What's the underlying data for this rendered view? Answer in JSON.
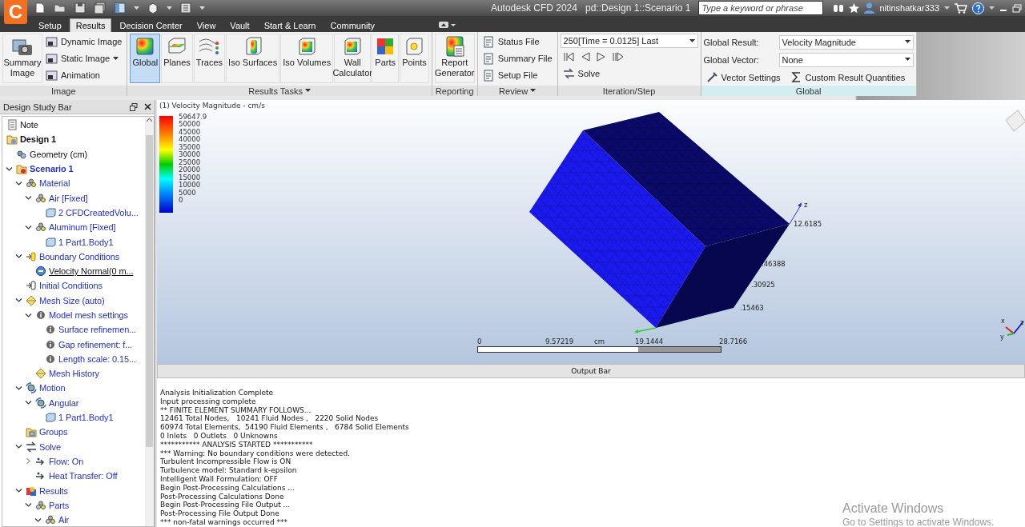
{
  "app": {
    "logo": "C",
    "title": "Autodesk CFD 2024",
    "document": "pd::Design 1::Scenario 1",
    "search": {
      "placeholder": "Type a keyword or phrase"
    },
    "user": "nitinshatkar333"
  },
  "tabs": [
    {
      "label": "Setup",
      "selected": false
    },
    {
      "label": "Results",
      "selected": true
    },
    {
      "label": "Decision Center",
      "selected": false
    },
    {
      "label": "View",
      "selected": false
    },
    {
      "label": "Vault",
      "selected": false
    },
    {
      "label": "Start & Learn",
      "selected": false
    },
    {
      "label": "Community",
      "selected": false
    }
  ],
  "ribbon": [
    {
      "kind": "image",
      "footer": "Image",
      "large": "Summary Image",
      "items": [
        {
          "label": "Dynamic Image",
          "menu": false
        },
        {
          "label": "Static Image",
          "menu": true
        },
        {
          "label": "Animation",
          "menu": false
        }
      ]
    },
    {
      "kind": "tasks",
      "footer": "Results Tasks",
      "menu": true,
      "tools": [
        {
          "label": "Global",
          "selected": true
        },
        {
          "label": "Planes",
          "selected": false
        },
        {
          "label": "Traces",
          "selected": false
        },
        {
          "label": "Iso Surfaces",
          "selected": false
        },
        {
          "label": "Iso Volumes",
          "selected": false
        },
        {
          "label": "Wall Calculator",
          "selected": false
        },
        {
          "label": "Parts",
          "selected": false
        },
        {
          "label": "Points",
          "selected": false
        }
      ]
    },
    {
      "kind": "reporting",
      "footer": "Reporting",
      "tool": "Report Generator"
    },
    {
      "kind": "review",
      "footer": "Review",
      "menu": true,
      "items": [
        {
          "label": "Status File",
          "menu": false
        },
        {
          "label": "Summary File",
          "menu": false
        },
        {
          "label": "Setup File",
          "menu": false
        }
      ]
    },
    {
      "kind": "iteration",
      "footer": "Iteration/Step",
      "step": "250[Time = 0.0125] Last",
      "action": "Solve"
    },
    {
      "kind": "global",
      "footer": "Global",
      "active": true,
      "fields": [
        {
          "label": "Global Result:",
          "value": "Velocity Magnitude"
        },
        {
          "label": "Global Vector:",
          "value": "None"
        }
      ],
      "actions": [
        "Vector Settings",
        "Custom Result Quantities"
      ]
    }
  ],
  "study_bar": {
    "title": "Design Study Bar",
    "tree": [
      {
        "kind": "note",
        "label": "Note"
      },
      {
        "kind": "design",
        "label": "Design 1",
        "children": [
          {
            "kind": "geometry",
            "label": "Geometry (cm)"
          },
          {
            "kind": "scenario",
            "label": "Scenario 1",
            "expanded": true,
            "children": [
              {
                "kind": "material",
                "label": "Material",
                "expanded": true,
                "children": [
                  {
                    "kind": "material",
                    "label": "Air [Fixed]",
                    "expanded": true,
                    "children": [
                      {
                        "kind": "body",
                        "label": "2 CFDCreatedVolu..."
                      }
                    ]
                  },
                  {
                    "kind": "material",
                    "label": "Aluminum [Fixed]",
                    "expanded": true,
                    "children": [
                      {
                        "kind": "body",
                        "label": "1 Part1.Body1"
                      }
                    ]
                  }
                ]
              },
              {
                "kind": "boundary",
                "label": "Boundary Conditions",
                "expanded": true,
                "children": [
                  {
                    "kind": "velocity",
                    "label": "Velocity Normal(0 m..."
                  }
                ]
              },
              {
                "kind": "initial",
                "label": "Initial Conditions"
              },
              {
                "kind": "mesh",
                "label": "Mesh Size (auto)",
                "expanded": true,
                "children": [
                  {
                    "kind": "info",
                    "label": "Model mesh settings",
                    "expanded": true,
                    "children": [
                      {
                        "kind": "info",
                        "label": "Surface refinemen..."
                      },
                      {
                        "kind": "info",
                        "label": "Gap refinement: f..."
                      },
                      {
                        "kind": "info",
                        "label": "Length scale: 0.15..."
                      }
                    ]
                  },
                  {
                    "kind": "mesh",
                    "label": "Mesh History"
                  }
                ]
              },
              {
                "kind": "motion",
                "label": "Motion",
                "expanded": true,
                "children": [
                  {
                    "kind": "motion",
                    "label": "Angular",
                    "expanded": true,
                    "children": [
                      {
                        "kind": "body",
                        "label": "1 Part1.Body1"
                      }
                    ]
                  }
                ]
              },
              {
                "kind": "groups",
                "label": "Groups"
              },
              {
                "kind": "solve",
                "label": "Solve",
                "expanded": true,
                "children": [
                  {
                    "kind": "flow",
                    "label": "Flow: On",
                    "expanded": false
                  },
                  {
                    "kind": "flow",
                    "label": "Heat Transfer: Off"
                  }
                ]
              },
              {
                "kind": "results",
                "label": "Results",
                "expanded": true,
                "children": [
                  {
                    "kind": "material",
                    "label": "Parts",
                    "expanded": true,
                    "children": [
                      {
                        "kind": "material",
                        "label": "Air",
                        "expanded": true
                      }
                    ]
                  }
                ]
              }
            ]
          }
        ]
      }
    ]
  },
  "viewport": {
    "legend": {
      "title": "(1) Velocity Magnitude - cm/s",
      "max": "59647.9",
      "ticks": [
        "50000",
        "45000",
        "40000",
        "35000",
        "30000",
        "25000",
        "20000",
        "15000",
        "10000",
        "5000",
        "0"
      ]
    },
    "axis_labels": [
      "z",
      "12.6185",
      ".46388",
      ".30925",
      ".15463"
    ],
    "scale": {
      "labels": [
        "0",
        "9.57219",
        "cm",
        "19.1444",
        "28.7166"
      ]
    },
    "triad": [
      "x",
      "y",
      "z"
    ]
  },
  "output": {
    "title": "Output Bar",
    "lines": [
      "Analysis Initialization Complete",
      "Input processing complete",
      "** FINITE ELEMENT SUMMARY FOLLOWS...",
      "12461 Total Nodes,   10241 Fluid Nodes ,   2220 Solid Nodes",
      "60974 Total Elements,  54190 Fluid Elements ,   6784 Solid Elements",
      "0 Inlets   0 Outlets   0 Unknowns",
      "*********** ANALYSIS STARTED ***********",
      "*** Warning: No boundary conditions were detected.",
      "Turbulent Incompressible Flow is ON",
      "Turbulence model: Standard k-epsilon",
      "Intelligent Wall Formulation: OFF",
      "Begin Post-Processing Calculations ...",
      "Post-Processing Calculations Done",
      "Begin Post-Processing File Output ...",
      "Post-Processing File Output Done",
      "*** non-fatal warnings occurred ***"
    ]
  },
  "os_notice": {
    "title": "Activate Windows",
    "subtitle": "Go to Settings to activate Windows."
  }
}
